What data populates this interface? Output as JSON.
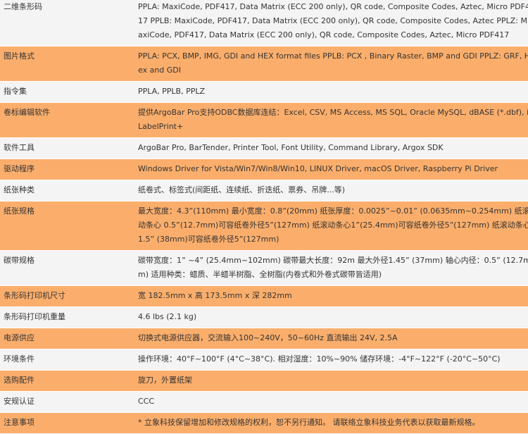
{
  "rows": [
    {
      "label": "二维条形码",
      "value": "PPLA: MaxiCode, PDF417, Data Matrix (ECC 200 only), QR code, Composite Codes, Aztec, Micro PDF417 PPLB: MaxiCode, PDF417, Data Matrix (ECC 200 only), QR code, Composite Codes, Aztec PPLZ: MaxiCode, PDF417, Data Matrix (ECC 200 only), QR code, Composite Codes, Aztec, Micro PDF417"
    },
    {
      "label": "图片格式",
      "value": "PPLA: PCX, BMP, IMG, GDI and HEX format files PPLB: PCX , Binary Raster, BMP and GDI PPLZ: GRF, Hex and GDI"
    },
    {
      "label": "指令集",
      "value": "PPLA, PPLB, PPLZ"
    },
    {
      "label": "卷标编辑软件",
      "value": "提供ArgoBar Pro支持ODBC数据库连结：Excel, CSV, MS Access, MS SQL, Oracle MySQL, dBASE (*.dbf), iLabelPrint+"
    },
    {
      "label": "软件工具",
      "value": "ArgoBar Pro, BarTender, Printer Tool, Font Utility, Command Library, Argox SDK"
    },
    {
      "label": "驱动程序",
      "value": "Windows Driver for Vista/Win7/Win8/Win10, LINUX Driver, macOS Driver, Raspberry Pi Driver"
    },
    {
      "label": "纸张种类",
      "value": "纸卷式、标签式(间距纸、连续纸、折迭纸、票券、吊牌...等)"
    },
    {
      "label": "纸张规格",
      "value": "最大宽度：4.3”(110mm) 最小宽度：0.8”(20mm) 纸张厚度：0.0025”~0.01” (0.0635mm~0.254mm) 纸滚动条心 0.5”(12.7mm)可容纸卷外径5”(127mm) 纸滚动条心1”(25.4mm)可容纸卷外径5”(127mm) 纸滚动条心1.5” (38mm)可容纸卷外径5”(127mm)"
    },
    {
      "label": "碳带规格",
      "value": "碳带宽度：1” ~4” (25.4mm~102mm) 碳带最大长度：92m 最大外径1.45” (37mm) 轴心内径：0.5” (12.7mm) 适用种类：蜡质、半蜡半树脂、全树脂(内卷式和外卷式碳带皆适用)"
    },
    {
      "label": "条形码打印机尺寸",
      "value": "宽 182.5mm x 高 173.5mm x 深 282mm"
    },
    {
      "label": "条形码打印机重量",
      "value": "4.6 lbs (2.1 kg)"
    },
    {
      "label": "电源供应",
      "value": "切换式电源供应器，交流输入100~240V，50~60Hz 直流输出 24V, 2.5A"
    },
    {
      "label": "环境条件",
      "value": "操作环境：40°F~100°F (4°C~38°C). 相对湿度：10%~90% 储存环境：-4°F~122°F (-20°C~50°C)"
    },
    {
      "label": "选购配件",
      "value": "旋刀，外置纸架"
    },
    {
      "label": "安规认证",
      "value": "CCC"
    },
    {
      "label": "注意事项",
      "value": "* 立象科技保留增加和修改规格的权利，恕不另行通知。 请联络立象科技业务代表以获取最新规格。"
    }
  ],
  "colors": {
    "odd_row": "#f4f4f4",
    "even_row": "#fbae6b",
    "text": "#333333"
  }
}
